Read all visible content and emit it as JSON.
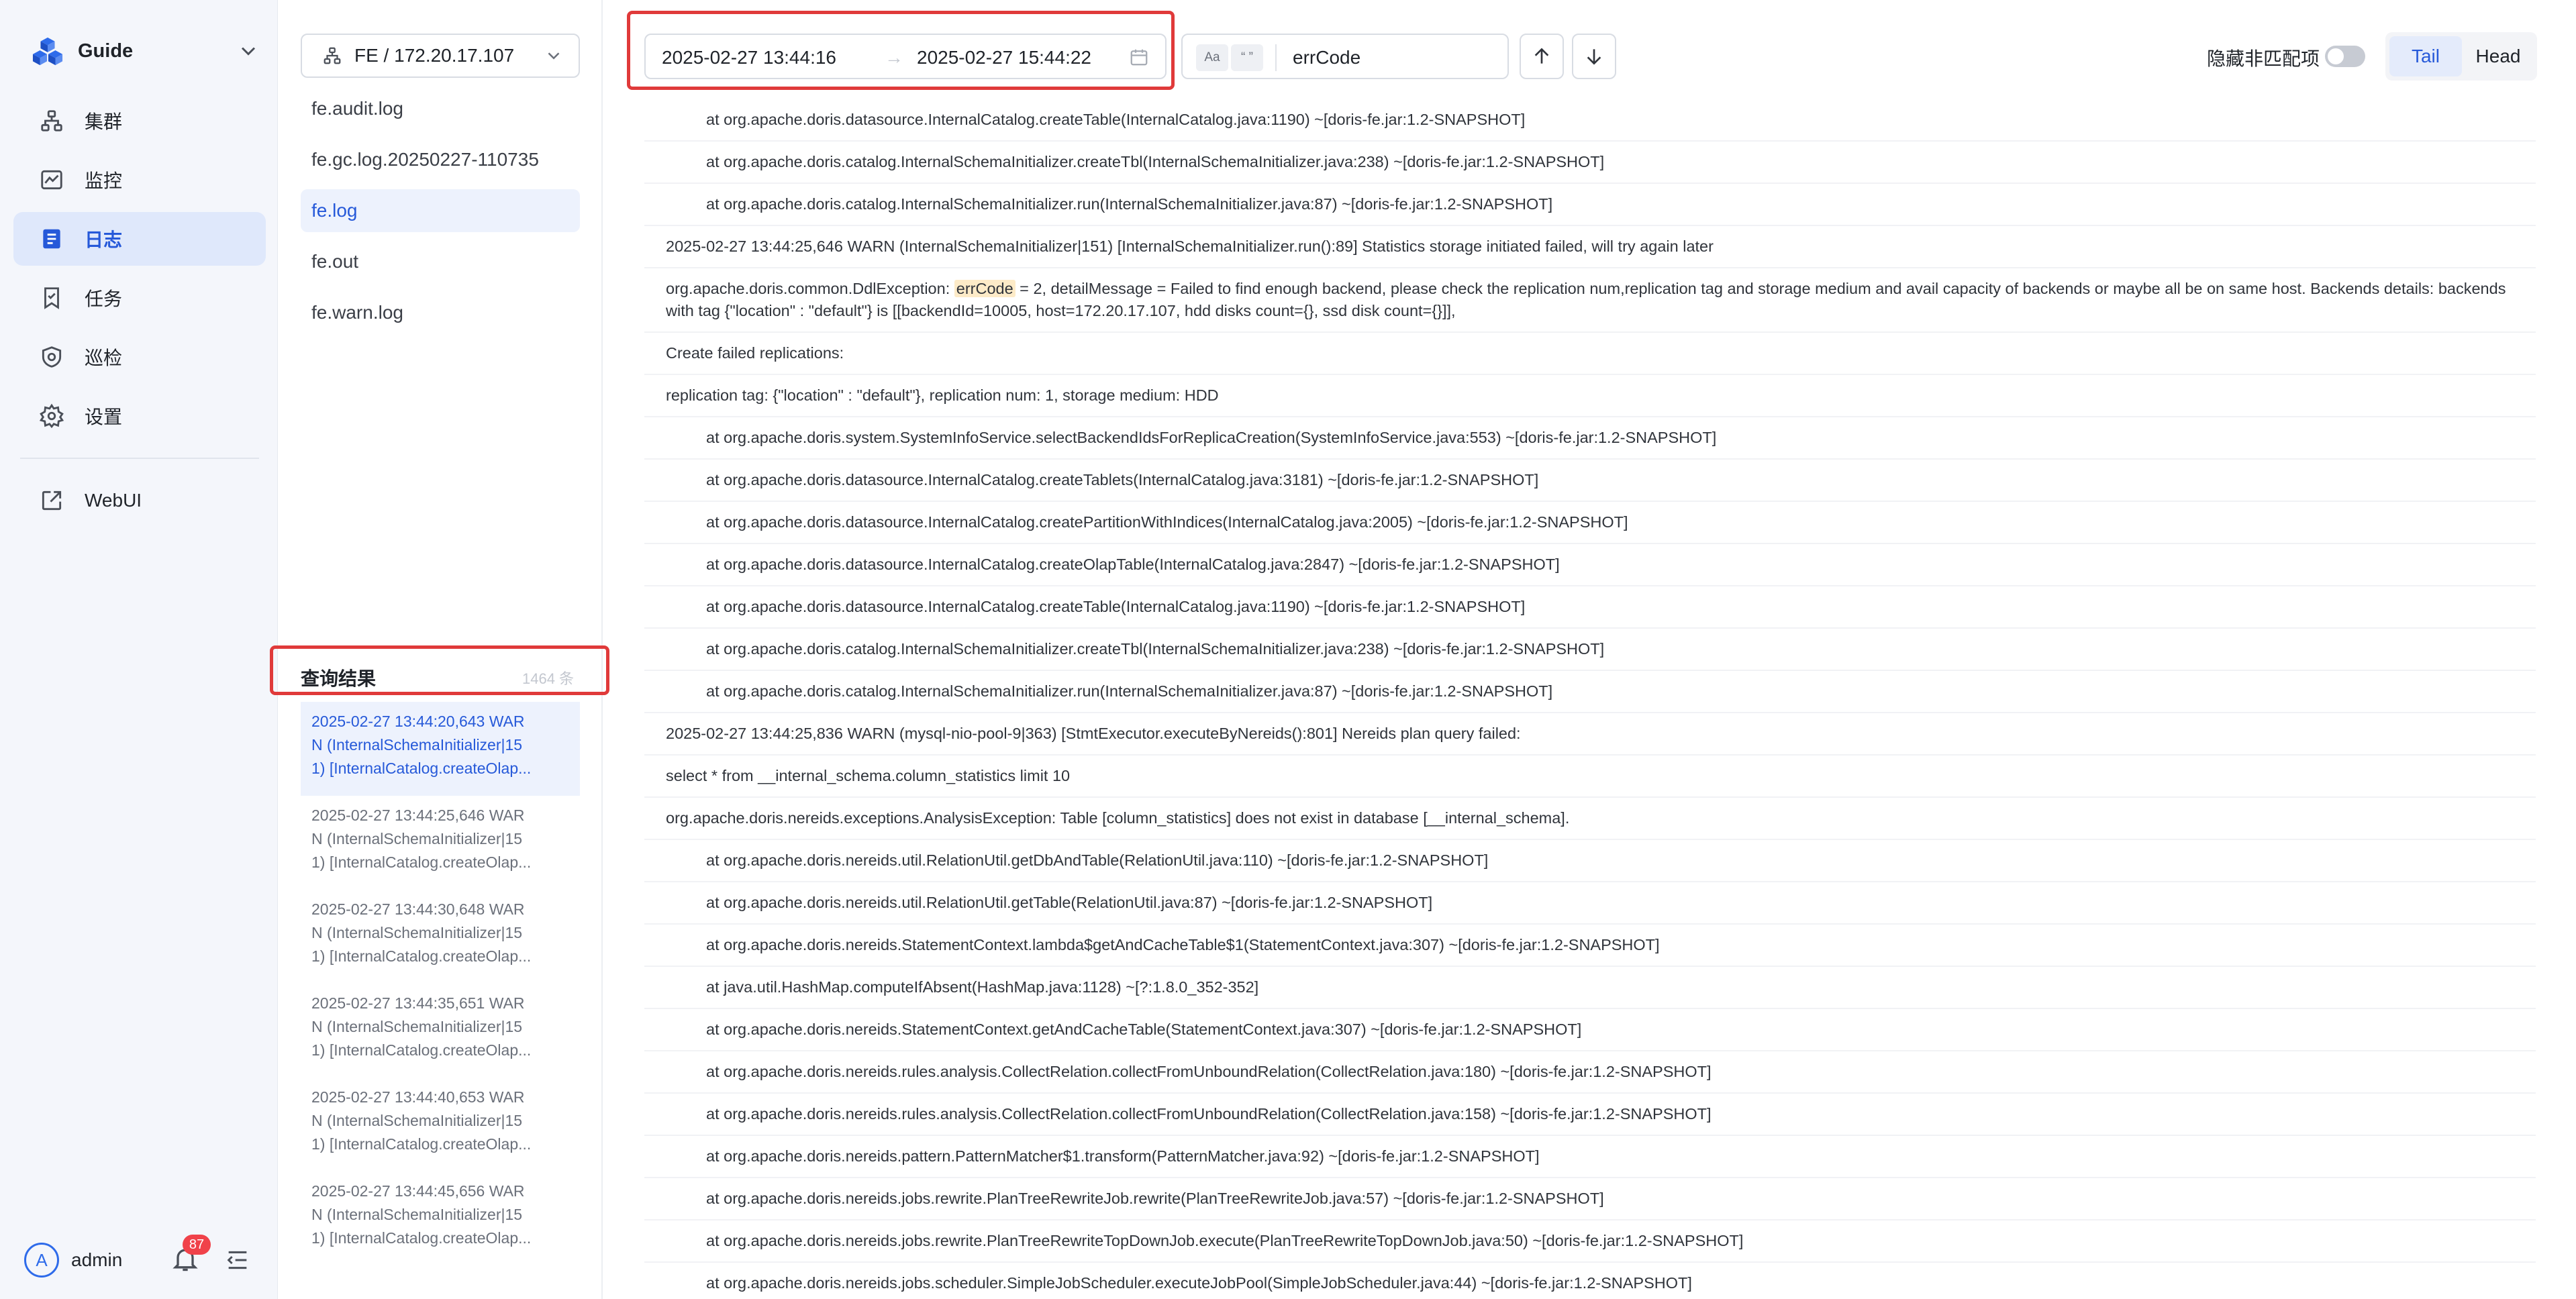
{
  "brand": {
    "name": "Guide",
    "logo_icon": "cubes-logo",
    "switch_icon": "chevron-down-icon"
  },
  "menu": [
    {
      "label": "集群",
      "icon": "cluster-icon",
      "active": false
    },
    {
      "label": "监控",
      "icon": "monitor-icon",
      "active": false
    },
    {
      "label": "日志",
      "icon": "log-icon",
      "active": true
    },
    {
      "label": "任务",
      "icon": "task-icon",
      "active": false
    },
    {
      "label": "巡检",
      "icon": "inspect-icon",
      "active": false
    },
    {
      "label": "设置",
      "icon": "gear-icon",
      "active": false
    }
  ],
  "webui": {
    "label": "WebUI",
    "icon": "external-link-icon"
  },
  "user": {
    "avatar_letter": "A",
    "name": "admin",
    "notifications": "87"
  },
  "node_select": {
    "value": "FE / 172.20.17.107"
  },
  "files": [
    {
      "name": "fe.audit.log",
      "active": false
    },
    {
      "name": "fe.gc.log.20250227-110735",
      "active": false
    },
    {
      "name": "fe.log",
      "active": true
    },
    {
      "name": "fe.out",
      "active": false
    },
    {
      "name": "fe.warn.log",
      "active": false
    }
  ],
  "query_results": {
    "title": "查询结果",
    "count": "1464 条",
    "items": [
      {
        "l1": "2025-02-27  13:44:20,643  WAR",
        "l2": "N  (InternalSchemaInitializer|15",
        "l3": "1)  [InternalCatalog.createOlap...",
        "active": true
      },
      {
        "l1": "2025-02-27  13:44:25,646  WAR",
        "l2": "N  (InternalSchemaInitializer|15",
        "l3": "1)  [InternalCatalog.createOlap...",
        "active": false
      },
      {
        "l1": "2025-02-27  13:44:30,648  WAR",
        "l2": "N  (InternalSchemaInitializer|15",
        "l3": "1)  [InternalCatalog.createOlap...",
        "active": false
      },
      {
        "l1": "2025-02-27  13:44:35,651  WAR",
        "l2": "N  (InternalSchemaInitializer|15",
        "l3": "1)  [InternalCatalog.createOlap...",
        "active": false
      },
      {
        "l1": "2025-02-27  13:44:40,653  WAR",
        "l2": "N  (InternalSchemaInitializer|15",
        "l3": "1)  [InternalCatalog.createOlap...",
        "active": false
      },
      {
        "l1": "2025-02-27  13:44:45,656  WAR",
        "l2": "N  (InternalSchemaInitializer|15",
        "l3": "1)  [InternalCatalog.createOlap...",
        "active": false
      }
    ]
  },
  "toolbar": {
    "time_start": "2025-02-27 13:44:16",
    "time_sep": "→",
    "time_end": "2025-02-27 15:44:22",
    "opt_case": "Aa",
    "opt_quote": "“ ”",
    "search_value": "errCode",
    "hide_label": "隐藏非匹配项",
    "tail_label": "Tail",
    "head_label": "Head"
  },
  "log_lines": [
    {
      "indent": true,
      "text": "at org.apache.doris.datasource.InternalCatalog.createTable(InternalCatalog.java:1190) ~[doris-fe.jar:1.2-SNAPSHOT]"
    },
    {
      "indent": true,
      "text": "at org.apache.doris.catalog.InternalSchemaInitializer.createTbl(InternalSchemaInitializer.java:238) ~[doris-fe.jar:1.2-SNAPSHOT]"
    },
    {
      "indent": true,
      "text": "at org.apache.doris.catalog.InternalSchemaInitializer.run(InternalSchemaInitializer.java:87) ~[doris-fe.jar:1.2-SNAPSHOT]"
    },
    {
      "indent": false,
      "text": "2025-02-27 13:44:25,646 WARN (InternalSchemaInitializer|151) [InternalSchemaInitializer.run():89] Statistics storage initiated failed, will try again later"
    },
    {
      "indent": false,
      "wrap": true,
      "pre": "org.apache.doris.common.DdlException: ",
      "hl": "errCode",
      "text": " = 2, detailMessage = Failed to find enough backend, please check the replication num,replication tag and storage medium and avail capacity of backends or maybe all be on same host. Backends details: backends with tag {\"location\" : \"default\"} is [[backendId=10005, host=172.20.17.107, hdd disks count={}, ssd disk count={}]],"
    },
    {
      "indent": false,
      "text": "Create failed replications:"
    },
    {
      "indent": false,
      "text": "replication tag: {\"location\" : \"default\"}, replication num: 1, storage medium: HDD"
    },
    {
      "indent": true,
      "text": "at org.apache.doris.system.SystemInfoService.selectBackendIdsForReplicaCreation(SystemInfoService.java:553) ~[doris-fe.jar:1.2-SNAPSHOT]"
    },
    {
      "indent": true,
      "text": "at org.apache.doris.datasource.InternalCatalog.createTablets(InternalCatalog.java:3181) ~[doris-fe.jar:1.2-SNAPSHOT]"
    },
    {
      "indent": true,
      "text": "at org.apache.doris.datasource.InternalCatalog.createPartitionWithIndices(InternalCatalog.java:2005) ~[doris-fe.jar:1.2-SNAPSHOT]"
    },
    {
      "indent": true,
      "text": "at org.apache.doris.datasource.InternalCatalog.createOlapTable(InternalCatalog.java:2847) ~[doris-fe.jar:1.2-SNAPSHOT]"
    },
    {
      "indent": true,
      "text": "at org.apache.doris.datasource.InternalCatalog.createTable(InternalCatalog.java:1190) ~[doris-fe.jar:1.2-SNAPSHOT]"
    },
    {
      "indent": true,
      "text": "at org.apache.doris.catalog.InternalSchemaInitializer.createTbl(InternalSchemaInitializer.java:238) ~[doris-fe.jar:1.2-SNAPSHOT]"
    },
    {
      "indent": true,
      "text": "at org.apache.doris.catalog.InternalSchemaInitializer.run(InternalSchemaInitializer.java:87) ~[doris-fe.jar:1.2-SNAPSHOT]"
    },
    {
      "indent": false,
      "text": "2025-02-27 13:44:25,836 WARN (mysql-nio-pool-9|363) [StmtExecutor.executeByNereids():801] Nereids plan query failed:"
    },
    {
      "indent": false,
      "text": "select * from __internal_schema.column_statistics limit 10"
    },
    {
      "indent": false,
      "text": "org.apache.doris.nereids.exceptions.AnalysisException: Table [column_statistics] does not exist in database [__internal_schema]."
    },
    {
      "indent": true,
      "text": "at org.apache.doris.nereids.util.RelationUtil.getDbAndTable(RelationUtil.java:110) ~[doris-fe.jar:1.2-SNAPSHOT]"
    },
    {
      "indent": true,
      "text": "at org.apache.doris.nereids.util.RelationUtil.getTable(RelationUtil.java:87) ~[doris-fe.jar:1.2-SNAPSHOT]"
    },
    {
      "indent": true,
      "text": "at org.apache.doris.nereids.StatementContext.lambda$getAndCacheTable$1(StatementContext.java:307) ~[doris-fe.jar:1.2-SNAPSHOT]"
    },
    {
      "indent": true,
      "text": "at java.util.HashMap.computeIfAbsent(HashMap.java:1128) ~[?:1.8.0_352-352]"
    },
    {
      "indent": true,
      "text": "at org.apache.doris.nereids.StatementContext.getAndCacheTable(StatementContext.java:307) ~[doris-fe.jar:1.2-SNAPSHOT]"
    },
    {
      "indent": true,
      "text": "at org.apache.doris.nereids.rules.analysis.CollectRelation.collectFromUnboundRelation(CollectRelation.java:180) ~[doris-fe.jar:1.2-SNAPSHOT]"
    },
    {
      "indent": true,
      "text": "at org.apache.doris.nereids.rules.analysis.CollectRelation.collectFromUnboundRelation(CollectRelation.java:158) ~[doris-fe.jar:1.2-SNAPSHOT]"
    },
    {
      "indent": true,
      "text": "at org.apache.doris.nereids.pattern.PatternMatcher$1.transform(PatternMatcher.java:92) ~[doris-fe.jar:1.2-SNAPSHOT]"
    },
    {
      "indent": true,
      "text": "at org.apache.doris.nereids.jobs.rewrite.PlanTreeRewriteJob.rewrite(PlanTreeRewriteJob.java:57) ~[doris-fe.jar:1.2-SNAPSHOT]"
    },
    {
      "indent": true,
      "text": "at org.apache.doris.nereids.jobs.rewrite.PlanTreeRewriteTopDownJob.execute(PlanTreeRewriteTopDownJob.java:50) ~[doris-fe.jar:1.2-SNAPSHOT]"
    },
    {
      "indent": true,
      "text": "at org.apache.doris.nereids.jobs.scheduler.SimpleJobScheduler.executeJobPool(SimpleJobScheduler.java:44) ~[doris-fe.jar:1.2-SNAPSHOT]"
    }
  ],
  "colors": {
    "accent": "#2659d9",
    "highlight_box": "#e03a3a",
    "match_bg": "#fdebc8",
    "badge": "#f0424a"
  }
}
